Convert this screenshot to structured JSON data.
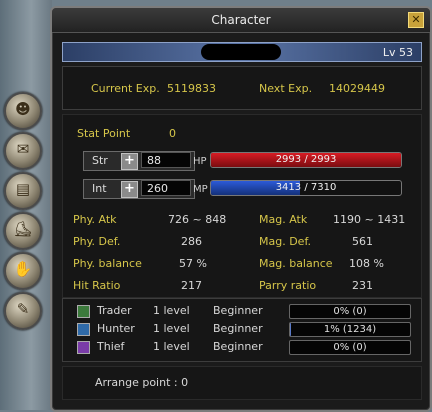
{
  "window": {
    "title": "Character",
    "close": "✕",
    "level": "Lv 53"
  },
  "exp": {
    "current_label": "Current Exp.",
    "current_value": "5119833",
    "next_label": "Next Exp.",
    "next_value": "14029449"
  },
  "stat_point": {
    "label": "Stat Point",
    "value": "0"
  },
  "str": {
    "label": "Str",
    "value": "88"
  },
  "int": {
    "label": "Int",
    "value": "260"
  },
  "hp": {
    "label": "HP",
    "text": "2993 / 2993",
    "fraction": 1.0,
    "color": "#d81c24"
  },
  "mp": {
    "label": "MP",
    "text": "3413 / 7310",
    "fraction": 0.467,
    "color": "#2c5ad8"
  },
  "stats": {
    "phy_atk_label": "Phy. Atk",
    "phy_atk": "726 ~ 848",
    "mag_atk_label": "Mag. Atk",
    "mag_atk": "1190 ~ 1431",
    "phy_def_label": "Phy. Def.",
    "phy_def": "286",
    "mag_def_label": "Mag. Def.",
    "mag_def": "561",
    "phy_bal_label": "Phy. balance",
    "phy_bal": "57 %",
    "mag_bal_label": "Mag. balance",
    "mag_bal": "108 %",
    "hit_label": "Hit Ratio",
    "hit": "217",
    "parry_label": "Parry ratio",
    "parry": "231"
  },
  "jobs": [
    {
      "name": "Trader",
      "level": "1 level",
      "rank": "Beginner",
      "progress_text": "0% (0)",
      "fraction": 0.0,
      "icon": "trader-icon",
      "color": "#3c7a3c"
    },
    {
      "name": "Hunter",
      "level": "1 level",
      "rank": "Beginner",
      "progress_text": "1% (1234)",
      "fraction": 0.01,
      "icon": "hunter-icon",
      "color": "#2f6aa8"
    },
    {
      "name": "Thief",
      "level": "1 level",
      "rank": "Beginner",
      "progress_text": "0% (0)",
      "fraction": 0.0,
      "icon": "thief-icon",
      "color": "#7a3ca8"
    }
  ],
  "arrange_point": "Arrange point : 0",
  "side_buttons": [
    "head-icon",
    "scroll-icon",
    "book-icon",
    "boot-icon",
    "handshake-icon",
    "quill-icon"
  ]
}
